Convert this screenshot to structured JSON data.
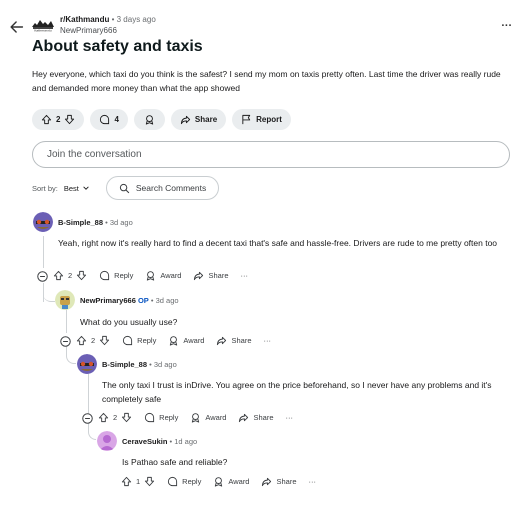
{
  "post": {
    "subreddit": "r/Kathmandu",
    "dot": "•",
    "age": "3 days ago",
    "author": "NewPrimary666",
    "more": "...",
    "title": "About safety and taxis",
    "body": "Hey everyone, which taxi do you think is the safest? I send my mom on taxis pretty often. Last time the driver was really rude and demanded more money than what the app showed",
    "votes": "2",
    "comments": "4",
    "share_label": "Share",
    "report_label": "Report"
  },
  "join_placeholder": "Join the conversation",
  "sort": {
    "label": "Sort by:",
    "value": "Best",
    "search_label": "Search Comments"
  },
  "comments": [
    {
      "user": "B-Simple_88",
      "op_label": "",
      "age": "• 3d ago",
      "body": "Yeah, right now it's really hard to find a decent taxi that's safe and hassle-free. Drivers are rude to me pretty often too",
      "votes": "2"
    },
    {
      "user": "NewPrimary666",
      "op_label": "OP",
      "age": "• 3d ago",
      "body": "What do you usually use?",
      "votes": "2"
    },
    {
      "user": "B-Simple_88",
      "op_label": "",
      "age": "• 3d ago",
      "body": "The only taxi I trust is inDrive. You agree on the price beforehand, so I never have any problems and it's completely safe",
      "votes": "2"
    },
    {
      "user": "CeraveSukin",
      "op_label": "",
      "age": "• 1d ago",
      "body": "Is Pathao safe and reliable?",
      "votes": "1"
    }
  ],
  "comment_actions": {
    "reply": "Reply",
    "award": "Award",
    "share": "Share",
    "more": "···"
  },
  "icons": {
    "back": "arrow-left-icon",
    "upvote": "arrow-up-icon",
    "downvote": "arrow-down-icon",
    "comment": "speech-bubble-icon",
    "award": "award-ribbon-icon",
    "share": "share-arrow-icon",
    "report": "flag-icon",
    "search": "search-icon",
    "collapse": "minus-circle-icon",
    "chevron": "chevron-down-icon"
  }
}
